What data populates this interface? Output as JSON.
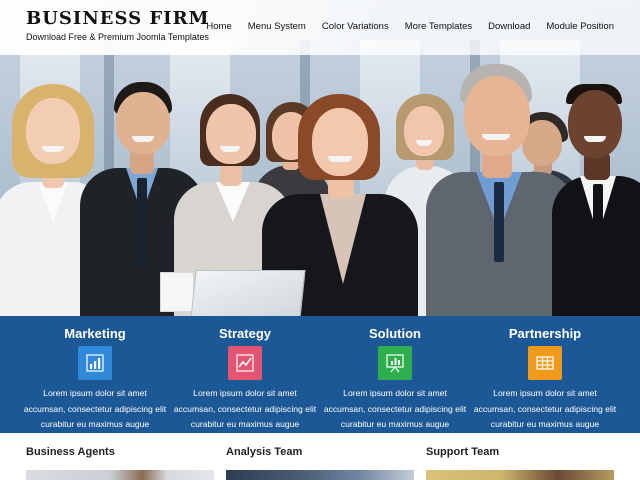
{
  "site": {
    "title": "BUSINESS FIRM",
    "tagline": "Download Free & Premium Joomla Templates"
  },
  "nav": {
    "items": [
      "Home",
      "Menu System",
      "Color Variations",
      "More Templates",
      "Download",
      "Module Position"
    ]
  },
  "hero": {
    "image": "group-of-business-people-photo"
  },
  "features": [
    {
      "title": "Marketing",
      "icon": "bar-chart-icon",
      "icon_color": "#2f89d8",
      "text": "Lorem ipsum dolor sit amet accumsan, consectetur adipiscing elit curabitur eu maximus augue consectetur cursus."
    },
    {
      "title": "Strategy",
      "icon": "line-chart-icon",
      "icon_color": "#e2546f",
      "text": "Lorem ipsum dolor sit amet accumsan, consectetur adipiscing elit curabitur eu maximus augue consectetur cursus."
    },
    {
      "title": "Solution",
      "icon": "presentation-chart-icon",
      "icon_color": "#2fae4e",
      "text": "Lorem ipsum dolor sit amet accumsan, consectetur adipiscing elit curabitur eu maximus augue consectetur cursus."
    },
    {
      "title": "Partnership",
      "icon": "table-grid-icon",
      "icon_color": "#f09a1c",
      "text": "Lorem ipsum dolor sit amet accumsan, consectetur adipiscing elit curabitur eu maximus augue consectetur cursus."
    }
  ],
  "teams": [
    {
      "title": "Business Agents"
    },
    {
      "title": "Analysis Team"
    },
    {
      "title": "Support Team"
    }
  ],
  "colors": {
    "features_band": "#1c5796",
    "header_text": "#111111"
  }
}
